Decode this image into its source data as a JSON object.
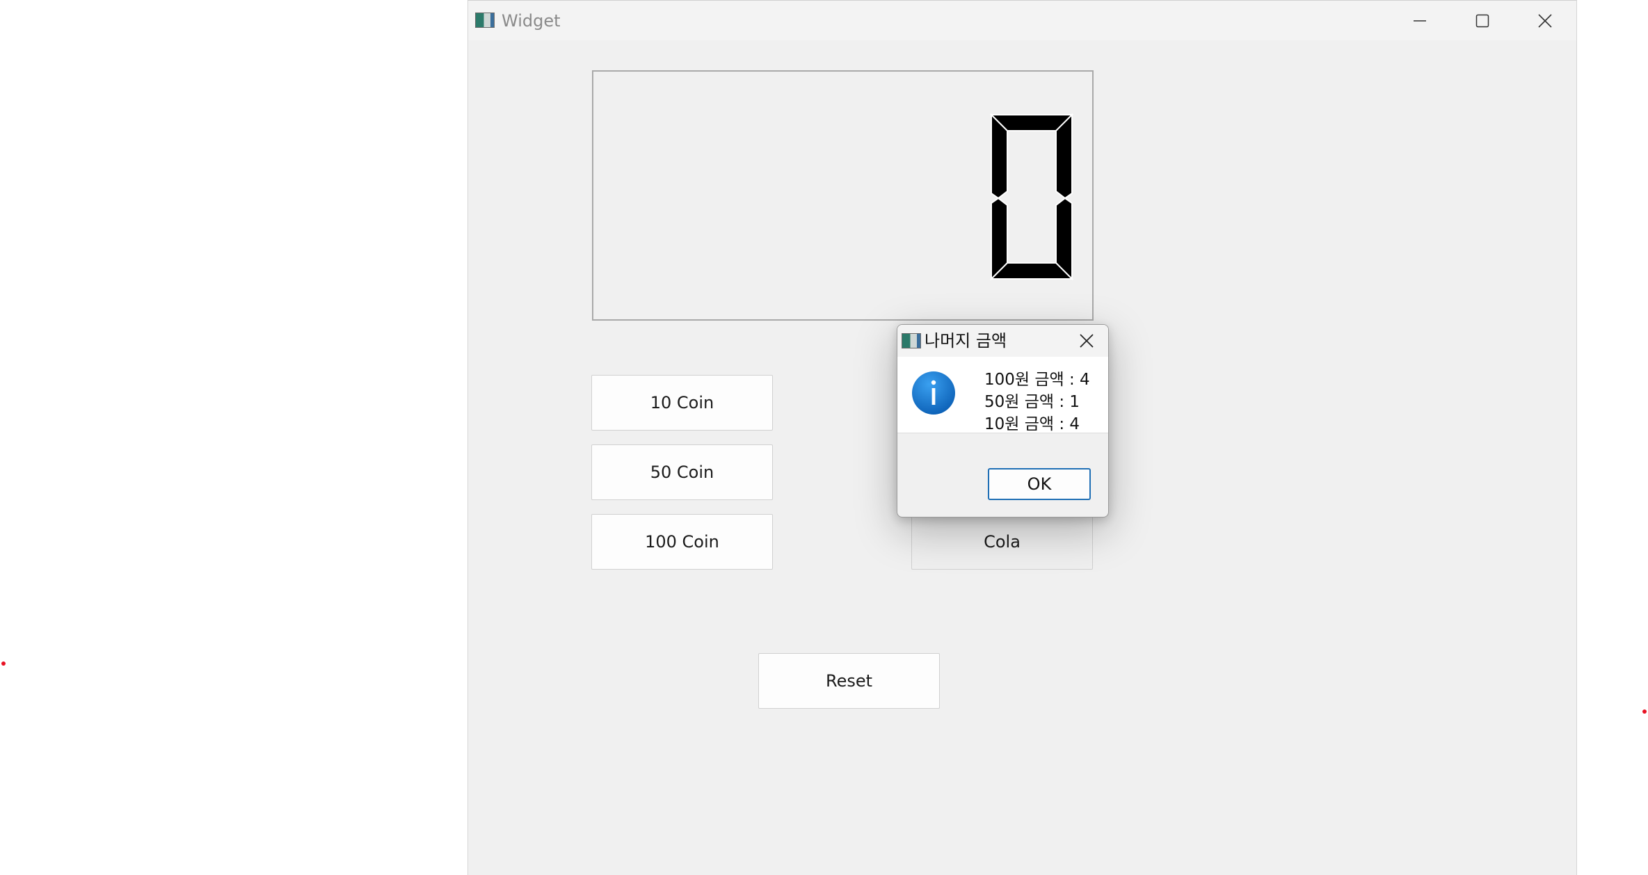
{
  "window": {
    "title": "Widget",
    "icon": "app-window-icon",
    "controls": [
      "minimize-icon",
      "maximize-icon",
      "close-icon"
    ]
  },
  "display": {
    "value": "0",
    "style": "lcd-seven-segment"
  },
  "buttons": {
    "coin10": "10 Coin",
    "coin50": "50 Coin",
    "coin100": "100 Coin",
    "cola": "Cola",
    "reset": "Reset"
  },
  "dialog": {
    "title": "나머지 금액",
    "icon": "information-icon",
    "lines": [
      "100원 금액 : 4",
      "50원 금액 : 1",
      "10원 금액 : 4"
    ],
    "ok_label": "OK"
  },
  "colors": {
    "window_bg": "#f0f0f0",
    "segment": "#000000",
    "info_blue": "#1676d2",
    "ok_border": "#1f6fb5",
    "marker_red": "#e81123"
  }
}
